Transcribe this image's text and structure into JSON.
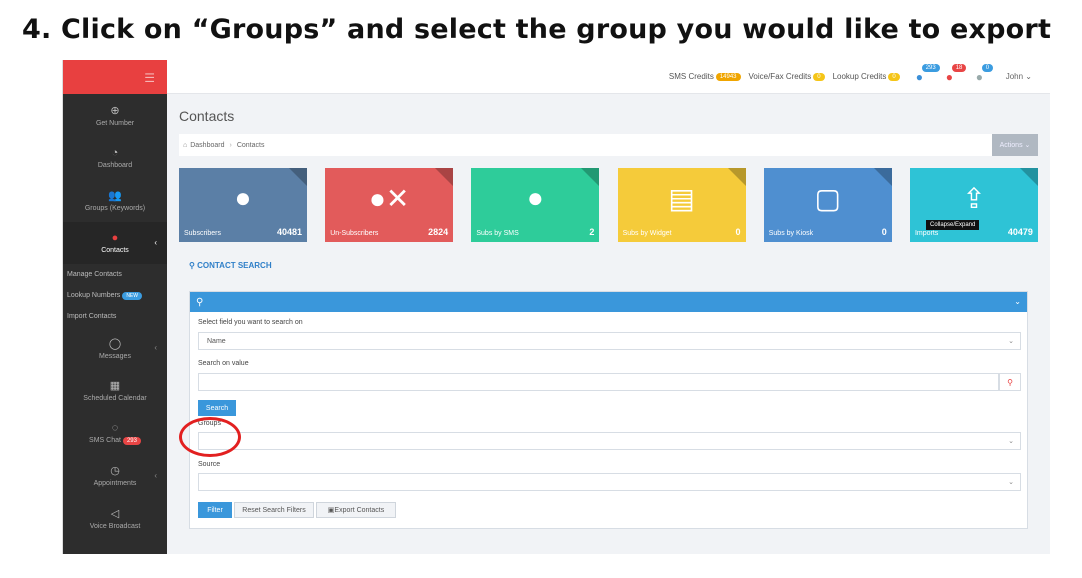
{
  "instruction": "4. Click on “Groups” and select the group you would like to export",
  "topbar": {
    "sms_credits_label": "SMS Credits",
    "sms_credits_value": "14943",
    "voice_label": "Voice/Fax Credits",
    "voice_value": "0",
    "lookup_label": "Lookup Credits",
    "lookup_value": "0",
    "chat_badge": "293",
    "notif_badge": "18",
    "user_badge": "0",
    "user_name": "John ⌄"
  },
  "sidebar": {
    "items": [
      {
        "label": "Get Number",
        "icon": "plus-circle-icon"
      },
      {
        "label": "Dashboard",
        "icon": "gauge-icon"
      },
      {
        "label": "Groups (Keywords)",
        "icon": "users-icon"
      },
      {
        "label": "Contacts",
        "icon": "user-icon"
      }
    ],
    "sub_items": [
      {
        "label": "Manage Contacts"
      },
      {
        "label": "Lookup Numbers",
        "badge": "NEW"
      },
      {
        "label": "Import Contacts"
      }
    ],
    "bottom_items": [
      {
        "label": "Messages",
        "icon": "speech-bubble-icon"
      },
      {
        "label": "Scheduled Calendar",
        "icon": "calendar-icon"
      },
      {
        "label": "SMS Chat",
        "badge": "293",
        "icon": "chat-icon"
      },
      {
        "label": "Appointments",
        "icon": "clock-icon"
      },
      {
        "label": "Voice Broadcast",
        "icon": "megaphone-icon"
      }
    ]
  },
  "page": {
    "title": "Contacts",
    "breadcrumb": [
      "Dashboard",
      "Contacts"
    ],
    "actions_label": "Actions ⌄"
  },
  "tiles": [
    {
      "label": "Subscribers",
      "value": "40481",
      "color": "#5b7fa6",
      "icon": "user-icon"
    },
    {
      "label": "Un-Subscribers",
      "value": "2824",
      "color": "#e25b5b",
      "icon": "user-remove-icon"
    },
    {
      "label": "Subs by SMS",
      "value": "2",
      "color": "#2ecc9a",
      "icon": "speech-bubble-icon"
    },
    {
      "label": "Subs by Widget",
      "value": "0",
      "color": "#f5cb3a",
      "icon": "document-icon"
    },
    {
      "label": "Subs by Kiosk",
      "value": "0",
      "color": "#4f8fd0",
      "icon": "tablet-icon"
    },
    {
      "label": "Imports",
      "value": "40479",
      "color": "#2ec3d6",
      "icon": "upload-icon"
    }
  ],
  "search": {
    "title": "CONTACT SEARCH",
    "tooltip": "Collapse/Expand",
    "field_label": "Select field you want to search on",
    "field_value": "Name",
    "value_label": "Search on value",
    "search_button": "Search",
    "groups_label": "Groups",
    "source_label": "Source",
    "filter_button": "Filter",
    "reset_button": "Reset Search Filters",
    "export_button": "Export Contacts"
  }
}
